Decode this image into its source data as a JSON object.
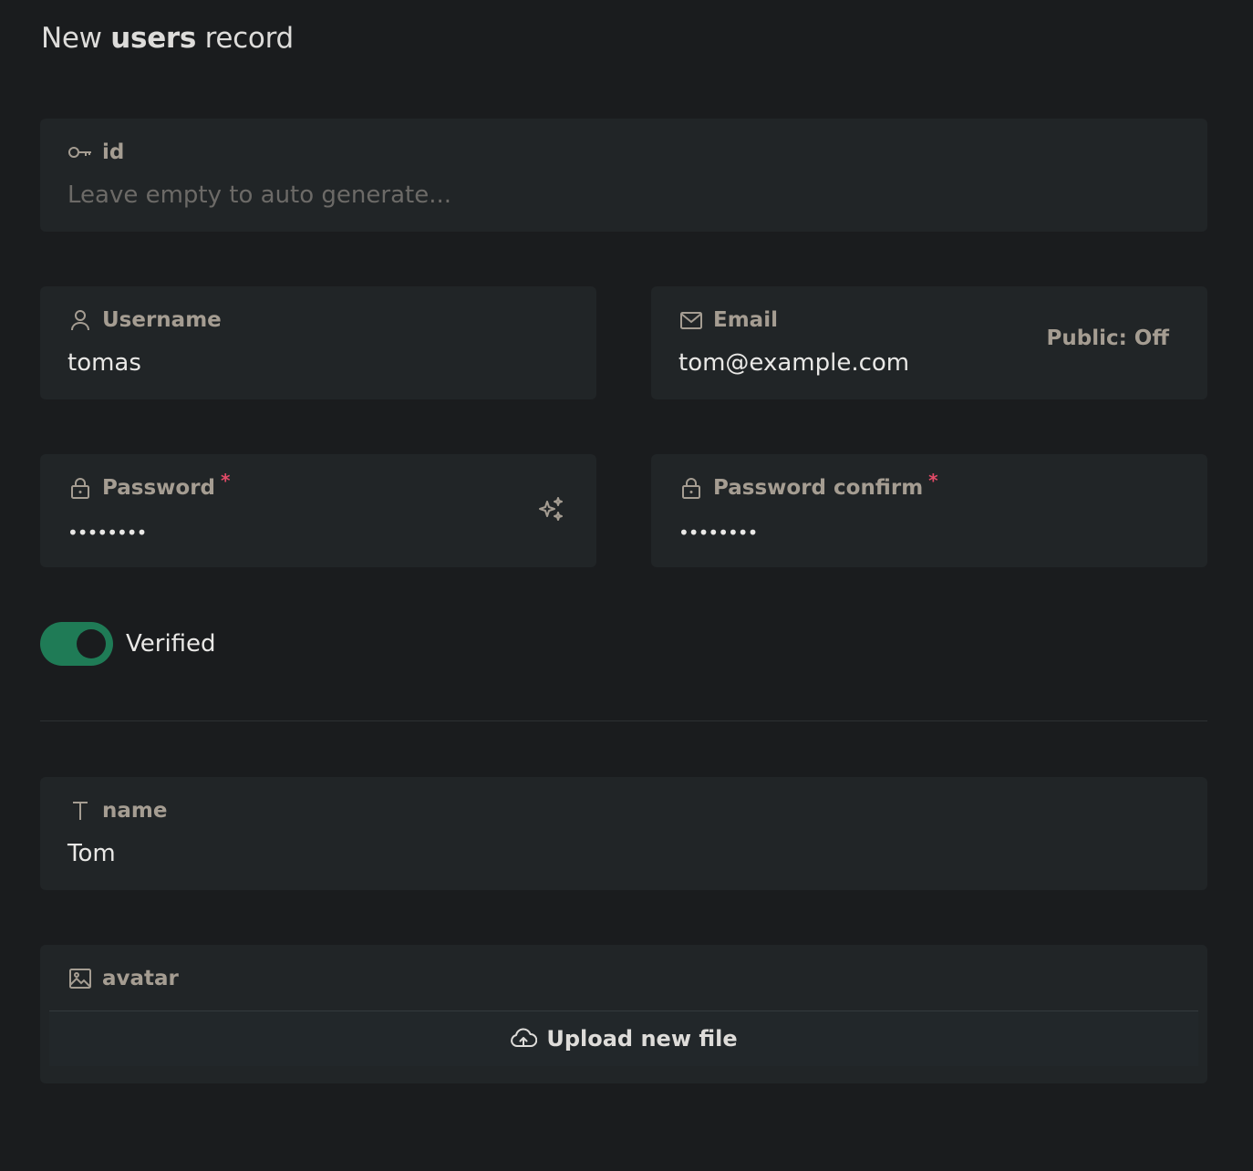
{
  "header": {
    "title_prefix": "New ",
    "collection": "users",
    "title_suffix": " record"
  },
  "fields": {
    "id": {
      "label": "id",
      "icon": "key-icon",
      "placeholder": "Leave empty to auto generate..."
    },
    "username": {
      "label": "Username",
      "icon": "user-icon",
      "value": "tomas"
    },
    "email": {
      "label": "Email",
      "icon": "mail-icon",
      "value": "tom@example.com",
      "visibility": "Public: Off"
    },
    "password": {
      "label": "Password",
      "icon": "lock-icon",
      "required_mark": "*",
      "value": "••••••••",
      "generate_icon": "sparkles-icon"
    },
    "password_confirm": {
      "label": "Password confirm",
      "icon": "lock-icon",
      "required_mark": "*",
      "value": "••••••••"
    },
    "verified": {
      "label": "Verified",
      "checked": true
    },
    "name": {
      "label": "name",
      "icon": "text-icon",
      "value": "Tom"
    },
    "avatar": {
      "label": "avatar",
      "icon": "image-icon",
      "upload_label": "Upload new file",
      "upload_icon": "cloud-upload-icon"
    }
  },
  "colors": {
    "background": "#1a1c1e",
    "field_bg": "#212527",
    "label": "#a59d92",
    "required": "#e24a67",
    "toggle_on": "#1f7b56"
  }
}
